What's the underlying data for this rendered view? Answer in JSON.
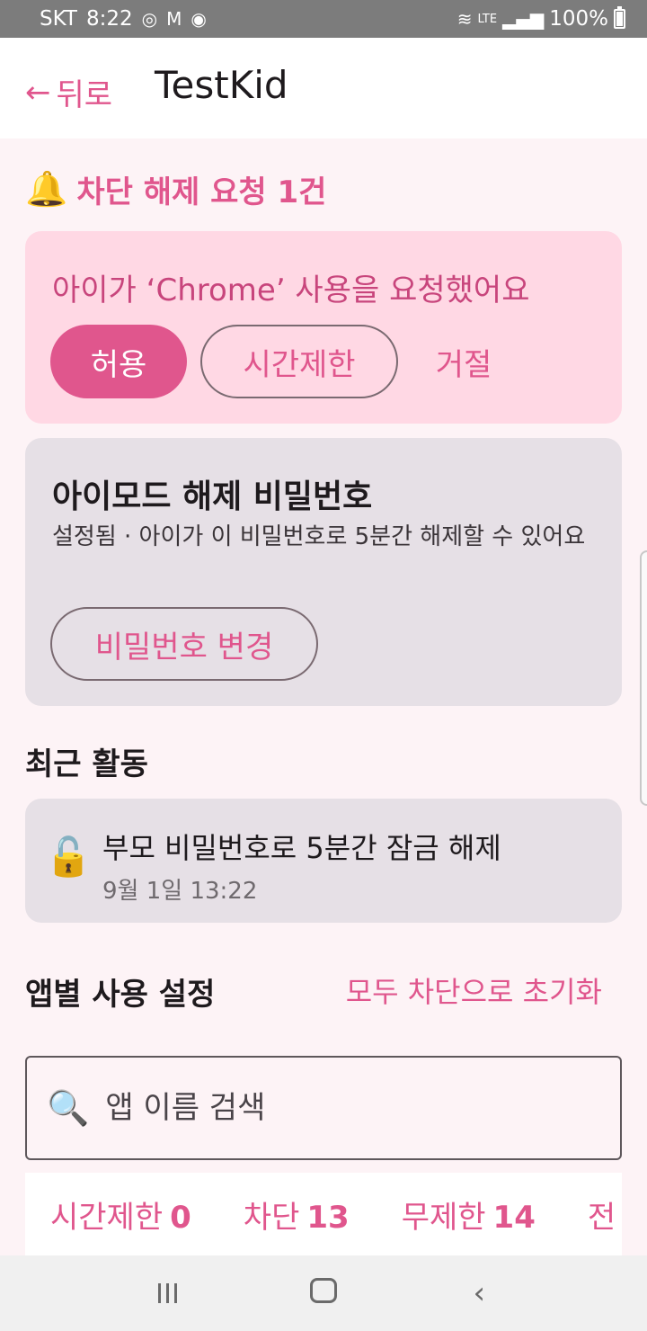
{
  "status_bar": {
    "carrier": "SKT",
    "time": "8:22",
    "signal_label": "LTE",
    "battery": "100%"
  },
  "appbar": {
    "back_label": "뒤로",
    "title": "TestKid"
  },
  "request": {
    "heading": "차단 해제 요청 1건",
    "message": "아이가 ‘Chrome’ 사용을 요청했어요",
    "allow_label": "허용",
    "time_limit_label": "시간제한",
    "deny_label": "거절"
  },
  "password": {
    "title": "아이모드 해제 비밀번호",
    "description": "설정됨 · 아이가 이 비밀번호로 5분간 해제할 수 있어요",
    "change_label": "비밀번호 변경"
  },
  "recent": {
    "heading": "최근 활동",
    "items": [
      {
        "text": "부모 비밀번호로 5분간 잠금 해제",
        "time": "9월 1일 13:22"
      }
    ]
  },
  "apps": {
    "heading": "앱별 사용 설정",
    "reset_label": "모두 차단으로 초기화",
    "search_placeholder": "앱 이름 검색",
    "tabs": [
      {
        "label": "시간제한",
        "count": "0"
      },
      {
        "label": "차단",
        "count": "13"
      },
      {
        "label": "무제한",
        "count": "14"
      },
      {
        "label": "전",
        "count": ""
      }
    ]
  },
  "icons": {
    "bell": "bell-icon",
    "lock": "lock-icon",
    "search": "search-icon"
  },
  "colors": {
    "accent": "#e0568d",
    "request_card": "#ffd8e4",
    "neutral_card": "#e6e0e6"
  }
}
